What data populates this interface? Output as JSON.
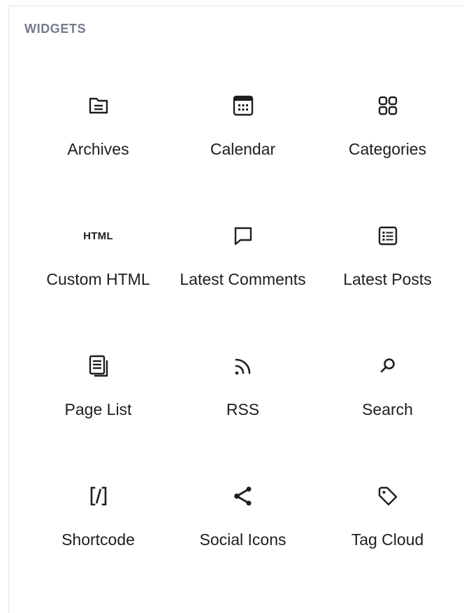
{
  "panel": {
    "title": "WIDGETS"
  },
  "widgets": [
    {
      "label": "Archives",
      "icon": "archive-icon"
    },
    {
      "label": "Calendar",
      "icon": "calendar-icon"
    },
    {
      "label": "Categories",
      "icon": "categories-icon"
    },
    {
      "label": "Custom HTML",
      "icon": "html-icon",
      "glyph": "HTML"
    },
    {
      "label": "Latest Comments",
      "icon": "comment-icon"
    },
    {
      "label": "Latest Posts",
      "icon": "post-list-icon"
    },
    {
      "label": "Page List",
      "icon": "pages-icon"
    },
    {
      "label": "RSS",
      "icon": "rss-icon"
    },
    {
      "label": "Search",
      "icon": "search-icon"
    },
    {
      "label": "Shortcode",
      "icon": "shortcode-icon"
    },
    {
      "label": "Social Icons",
      "icon": "share-icon"
    },
    {
      "label": "Tag Cloud",
      "icon": "tag-icon"
    }
  ]
}
